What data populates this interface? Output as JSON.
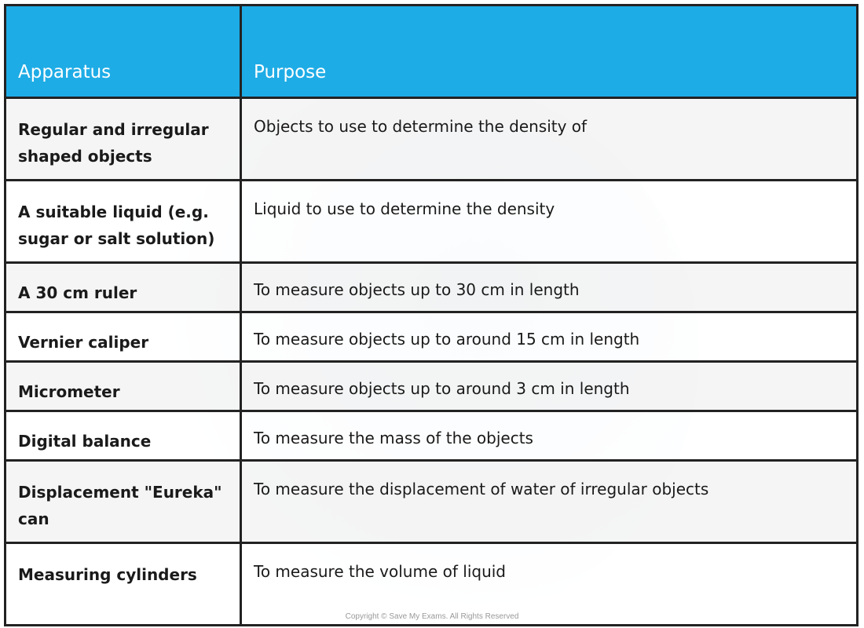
{
  "table": {
    "headers": {
      "apparatus": "Apparatus",
      "purpose": "Purpose"
    },
    "rows": [
      {
        "apparatus": "Regular and irregular shaped objects",
        "purpose": "Objects to use to determine the density of"
      },
      {
        "apparatus": "A suitable liquid (e.g. sugar or salt solution)",
        "purpose": "Liquid to use to determine the density"
      },
      {
        "apparatus": "A 30 cm ruler",
        "purpose": "To measure objects up to 30 cm in length"
      },
      {
        "apparatus": "Vernier caliper",
        "purpose": "To measure objects up to around 15 cm in length"
      },
      {
        "apparatus": "Micrometer",
        "purpose": "To measure objects up to around 3 cm in length"
      },
      {
        "apparatus": "Digital balance",
        "purpose": "To measure the mass of the objects"
      },
      {
        "apparatus": "Displacement \"Eureka\" can",
        "purpose": "To measure the displacement of water of irregular objects"
      },
      {
        "apparatus": "Measuring cylinders",
        "purpose": "To measure the volume of liquid"
      }
    ]
  },
  "colors": {
    "header_bg": "#1eace6",
    "border": "#222222"
  },
  "copyright": "Copyright © Save My Exams. All Rights Reserved"
}
